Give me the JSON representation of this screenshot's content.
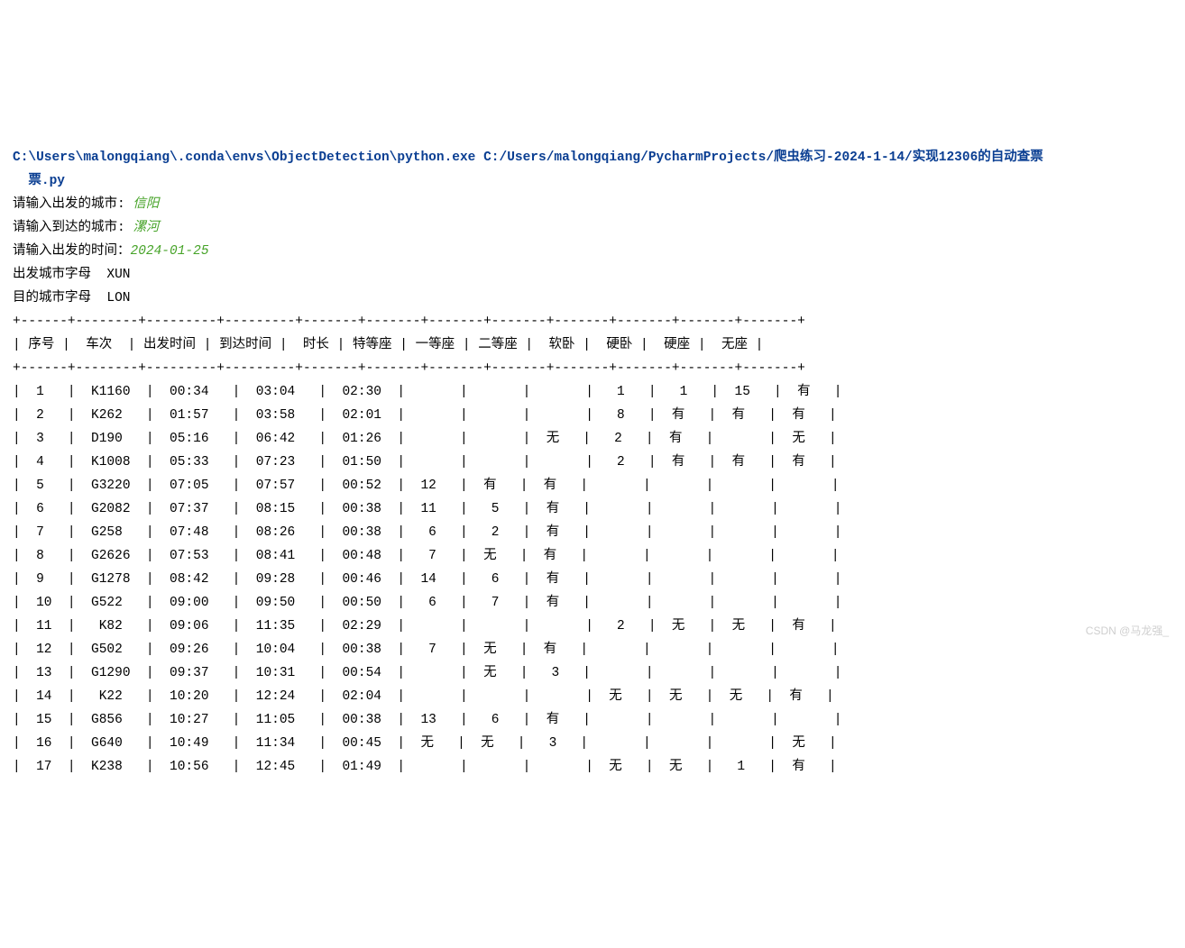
{
  "command": {
    "part1": "C:\\Users\\malongqiang\\.conda\\envs\\ObjectDetection\\python.exe",
    "part2": "C:/Users/malongqiang/PycharmProjects/爬虫练习-2024-1-14/实现12306的自动查票",
    "part3": "票.py"
  },
  "prompts": {
    "depart_city_label": "请输入出发的城市: ",
    "depart_city_value": "信阳",
    "arrive_city_label": "请输入到达的城市: ",
    "arrive_city_value": "漯河",
    "depart_time_label": "请输入出发的时间：",
    "depart_time_value": "2024-01-25",
    "depart_code_line": "出发城市字母  XUN",
    "arrive_code_line": "目的城市字母  LON"
  },
  "table": {
    "sep_top": "+------+--------+---------+---------+-------+-------+-------+-------+-------+-------+-------+-------+",
    "header": "| 序号 |  车次  | 出发时间 | 到达时间 |  时长 | 特等座 | 一等座 | 二等座 |  软卧 |  硬卧 |  硬座 |  无座 |",
    "sep_mid": "+------+--------+---------+---------+-------+-------+-------+-------+-------+-------+-------+-------+",
    "headers": [
      "序号",
      "车次",
      "出发时间",
      "到达时间",
      "时长",
      "特等座",
      "一等座",
      "二等座",
      "软卧",
      "硬卧",
      "硬座",
      "无座"
    ],
    "rows": [
      {
        "n": "1",
        "train": "K1160",
        "dep": "00:34",
        "arr": "03:04",
        "dur": "02:30",
        "te": "",
        "yi": "",
        "er": "",
        "rw": "1",
        "yw": "1",
        "yz": "15",
        "wz": "有"
      },
      {
        "n": "2",
        "train": "K262",
        "dep": "01:57",
        "arr": "03:58",
        "dur": "02:01",
        "te": "",
        "yi": "",
        "er": "",
        "rw": "8",
        "yw": "有",
        "yz": "有",
        "wz": "有"
      },
      {
        "n": "3",
        "train": "D190",
        "dep": "05:16",
        "arr": "06:42",
        "dur": "01:26",
        "te": "",
        "yi": "",
        "er": "无",
        "rw": "2",
        "yw": "有",
        "yz": "",
        "wz": "无"
      },
      {
        "n": "4",
        "train": "K1008",
        "dep": "05:33",
        "arr": "07:23",
        "dur": "01:50",
        "te": "",
        "yi": "",
        "er": "",
        "rw": "2",
        "yw": "有",
        "yz": "有",
        "wz": "有"
      },
      {
        "n": "5",
        "train": "G3220",
        "dep": "07:05",
        "arr": "07:57",
        "dur": "00:52",
        "te": "12",
        "yi": "有",
        "er": "有",
        "rw": "",
        "yw": "",
        "yz": "",
        "wz": ""
      },
      {
        "n": "6",
        "train": "G2082",
        "dep": "07:37",
        "arr": "08:15",
        "dur": "00:38",
        "te": "11",
        "yi": "5",
        "er": "有",
        "rw": "",
        "yw": "",
        "yz": "",
        "wz": ""
      },
      {
        "n": "7",
        "train": "G258",
        "dep": "07:48",
        "arr": "08:26",
        "dur": "00:38",
        "te": "6",
        "yi": "2",
        "er": "有",
        "rw": "",
        "yw": "",
        "yz": "",
        "wz": ""
      },
      {
        "n": "8",
        "train": "G2626",
        "dep": "07:53",
        "arr": "08:41",
        "dur": "00:48",
        "te": "7",
        "yi": "无",
        "er": "有",
        "rw": "",
        "yw": "",
        "yz": "",
        "wz": ""
      },
      {
        "n": "9",
        "train": "G1278",
        "dep": "08:42",
        "arr": "09:28",
        "dur": "00:46",
        "te": "14",
        "yi": "6",
        "er": "有",
        "rw": "",
        "yw": "",
        "yz": "",
        "wz": ""
      },
      {
        "n": "10",
        "train": "G522",
        "dep": "09:00",
        "arr": "09:50",
        "dur": "00:50",
        "te": "6",
        "yi": "7",
        "er": "有",
        "rw": "",
        "yw": "",
        "yz": "",
        "wz": ""
      },
      {
        "n": "11",
        "train": "K82",
        "dep": "09:06",
        "arr": "11:35",
        "dur": "02:29",
        "te": "",
        "yi": "",
        "er": "",
        "rw": "2",
        "yw": "无",
        "yz": "无",
        "wz": "有"
      },
      {
        "n": "12",
        "train": "G502",
        "dep": "09:26",
        "arr": "10:04",
        "dur": "00:38",
        "te": "7",
        "yi": "无",
        "er": "有",
        "rw": "",
        "yw": "",
        "yz": "",
        "wz": ""
      },
      {
        "n": "13",
        "train": "G1290",
        "dep": "09:37",
        "arr": "10:31",
        "dur": "00:54",
        "te": "",
        "yi": "无",
        "er": "3",
        "rw": "",
        "yw": "",
        "yz": "",
        "wz": ""
      },
      {
        "n": "14",
        "train": "K22",
        "dep": "10:20",
        "arr": "12:24",
        "dur": "02:04",
        "te": "",
        "yi": "",
        "er": "",
        "rw": "无",
        "yw": "无",
        "yz": "无",
        "wz": "有"
      },
      {
        "n": "15",
        "train": "G856",
        "dep": "10:27",
        "arr": "11:05",
        "dur": "00:38",
        "te": "13",
        "yi": "6",
        "er": "有",
        "rw": "",
        "yw": "",
        "yz": "",
        "wz": ""
      },
      {
        "n": "16",
        "train": "G640",
        "dep": "10:49",
        "arr": "11:34",
        "dur": "00:45",
        "te": "无",
        "yi": "无",
        "er": "3",
        "rw": "",
        "yw": "",
        "yz": "",
        "wz": "无"
      },
      {
        "n": "17",
        "train": "K238",
        "dep": "10:56",
        "arr": "12:45",
        "dur": "01:49",
        "te": "",
        "yi": "",
        "er": "",
        "rw": "无",
        "yw": "无",
        "yz": "1",
        "wz": "有"
      }
    ]
  },
  "watermark": "CSDN @马龙强_"
}
